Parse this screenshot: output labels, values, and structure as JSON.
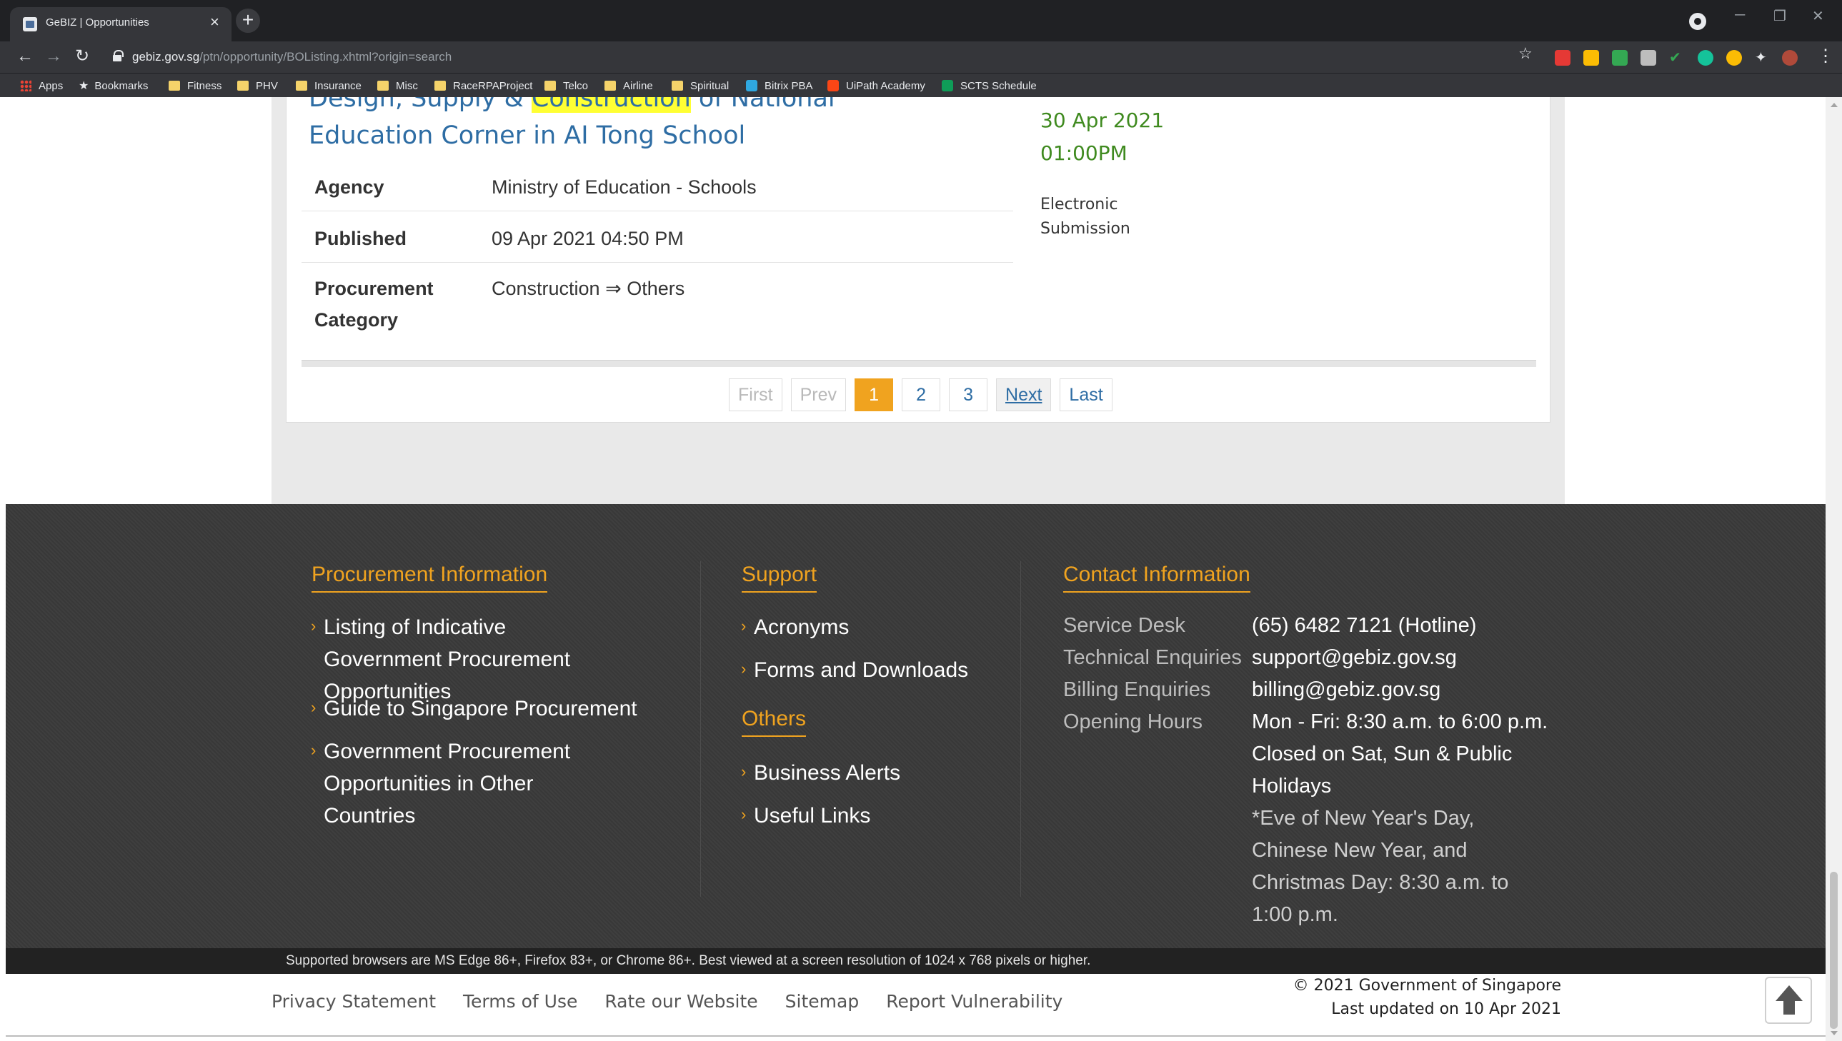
{
  "browser": {
    "tab_title": "GeBIZ | Opportunities",
    "url_host": "gebiz.gov.sg",
    "url_path": "/ptn/opportunity/BOListing.xhtml?origin=search",
    "bookmarks": [
      "Apps",
      "Bookmarks",
      "Fitness",
      "PHV",
      "Insurance",
      "Misc",
      "RaceRPAProject",
      "Telco",
      "Airline",
      "Spiritual",
      "Bitrix PBA",
      "UiPath Academy",
      "SCTS Schedule"
    ]
  },
  "opportunity": {
    "title_before": "Design, Supply & ",
    "title_highlight": "Construction",
    "title_after": " of National Education Corner in AI Tong School",
    "rows": [
      {
        "label": "Agency",
        "value": "Ministry of Education - Schools"
      },
      {
        "label": "Published",
        "value": "09 Apr 2021 04:50 PM"
      },
      {
        "label": "Procurement Category",
        "value": "Construction ⇒ Others"
      }
    ],
    "closing_date": "30 Apr 2021",
    "closing_time": "01:00PM",
    "submission": "Electronic Submission"
  },
  "pagination": {
    "first": "First",
    "prev": "Prev",
    "pages": [
      "1",
      "2",
      "3"
    ],
    "current": "1",
    "next": "Next",
    "last": "Last"
  },
  "footer": {
    "procurement": {
      "heading": "Procurement Information",
      "links": [
        "Listing of Indicative Government Procurement Opportunities",
        "Guide to Singapore Procurement",
        "Government Procurement Opportunities in Other Countries"
      ]
    },
    "support": {
      "heading": "Support",
      "links": [
        "Acronyms",
        "Forms and Downloads"
      ]
    },
    "others": {
      "heading": "Others",
      "links": [
        "Business Alerts",
        "Useful Links"
      ]
    },
    "contact": {
      "heading": "Contact Information",
      "service_desk_label": "Service Desk",
      "service_desk_value": "(65) 6482 7121 (Hotline)",
      "technical_label": "Technical Enquiries",
      "technical_value": "support@gebiz.gov.sg",
      "billing_label": "Billing Enquiries",
      "billing_value": "billing@gebiz.gov.sg",
      "hours_label": "Opening Hours",
      "hours_line1": "Mon - Fri: 8:30 a.m. to 6:00 p.m.",
      "hours_line2": "Closed on Sat, Sun & Public Holidays",
      "hours_note": "*Eve of New Year's Day, Chinese New Year, and Christmas Day: 8:30 a.m. to 1:00 p.m."
    },
    "browser_note": "Supported browsers are MS Edge 86+, Firefox 83+, or Chrome 86+. Best viewed at a screen resolution of 1024 x 768 pixels or higher.",
    "bottom_links": [
      "Privacy Statement",
      "Terms of Use",
      "Rate our Website",
      "Sitemap",
      "Report Vulnerability"
    ],
    "copyright": "© 2021 Government of Singapore",
    "last_updated": "Last updated on 10 Apr 2021"
  },
  "colors": {
    "link_blue": "#2e6da4",
    "accent_orange": "#f0a31f",
    "closing_green": "#3f8a1f",
    "highlight": "#ffff33",
    "footer_bg": "#3a3a3a"
  },
  "icons": [
    "back-icon",
    "forward-icon",
    "reload-icon",
    "lock-icon",
    "bookmark-star-icon",
    "extensions-icon",
    "menu-icon",
    "back-to-top-icon"
  ]
}
